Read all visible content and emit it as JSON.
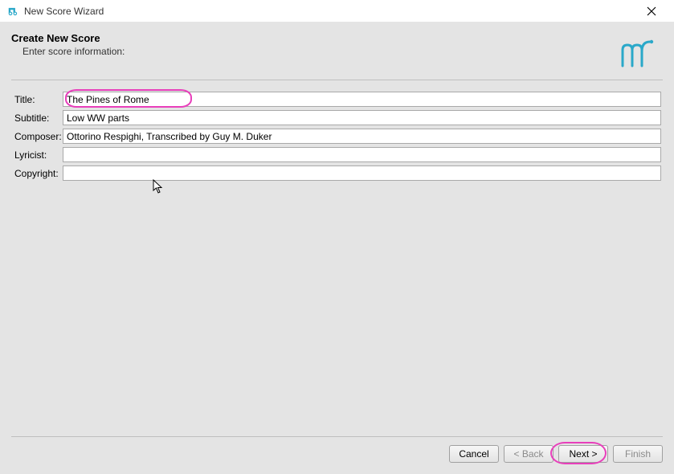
{
  "window": {
    "title": "New Score Wizard"
  },
  "header": {
    "heading": "Create New Score",
    "subheading": "Enter score information:"
  },
  "form": {
    "title_label": "Title:",
    "title_value": "The Pines of Rome",
    "subtitle_label": "Subtitle:",
    "subtitle_value": "Low WW parts",
    "composer_label": "Composer:",
    "composer_value": "Ottorino Respighi, Transcribed by Guy M. Duker",
    "lyricist_label": "Lyricist:",
    "lyricist_value": "",
    "copyright_label": "Copyright:",
    "copyright_value": ""
  },
  "buttons": {
    "cancel": "Cancel",
    "back": "< Back",
    "next": "Next >",
    "finish": "Finish"
  }
}
